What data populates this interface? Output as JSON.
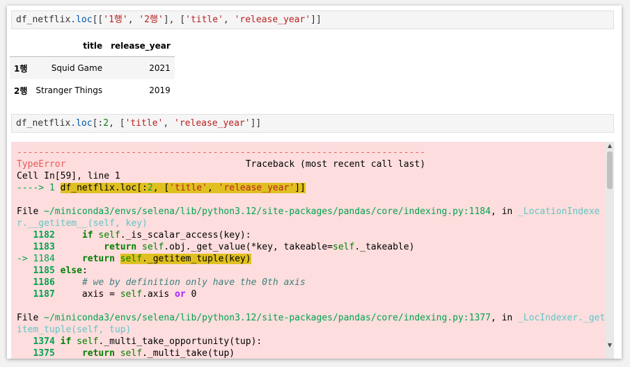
{
  "cells": {
    "in1": {
      "var": "df_netflix",
      "attr": ".loc",
      "open": "[[",
      "row1": "'1행'",
      "comma1": ", ",
      "row2": "'2행'",
      "close1": "], [",
      "col1": "'title'",
      "comma2": ", ",
      "col2": "'release_year'",
      "close2": "]]"
    },
    "in2": {
      "var": "df_netflix",
      "attr": ".loc",
      "open": "[:",
      "num": "2",
      "comma1": ", [",
      "col1": "'title'",
      "comma2": ", ",
      "col2": "'release_year'",
      "close": "]]"
    }
  },
  "dataframe": {
    "columns": [
      "",
      "title",
      "release_year"
    ],
    "rows": [
      {
        "index": "1행",
        "title": "Squid Game",
        "release_year": "2021"
      },
      {
        "index": "2행",
        "title": "Stranger Things",
        "release_year": "2019"
      }
    ]
  },
  "error": {
    "dashes": "---------------------------------------------------------------------------",
    "type": "TypeError",
    "traceback_label": "Traceback (most recent call last)",
    "cell_line": "Cell In[59], line 1",
    "arrow1": "----> 1 ",
    "code1": "df_netflix.loc[:2, ['title', 'release_year']]",
    "file1_prefix": "File ",
    "file1_path": "~/miniconda3/envs/selena/lib/python3.12/site-packages/pandas/core/indexing.py:1184",
    "file1_in": ", in ",
    "file1_func_a": "_LocationIndexe",
    "file1_func_b": "r.__getitem__(self, key)",
    "l1182": "1182",
    "l1183": "1183",
    "l1184_arrow": "-> 1184",
    "l1185": "1185",
    "l1186": "1186",
    "l1187": "1187",
    "file2_prefix": "File ",
    "file2_path": "~/miniconda3/envs/selena/lib/python3.12/site-packages/pandas/core/indexing.py:1377",
    "file2_in": ", in ",
    "file2_func_a": "_LocIndexer._get",
    "file2_func_b": "item_tuple(self, tup)",
    "l1374": "1374",
    "l1375": "1375"
  }
}
